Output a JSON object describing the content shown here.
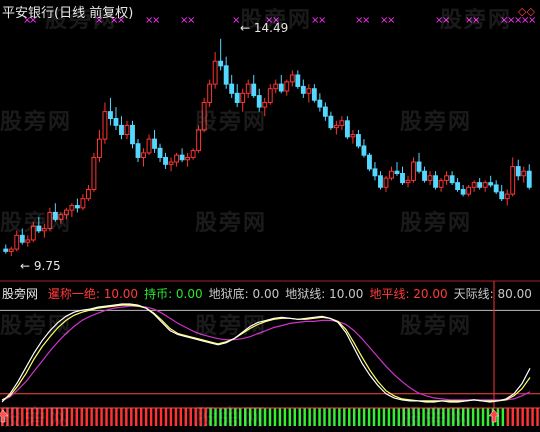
{
  "header": {
    "title": "平安银行(日线 前复权)",
    "diamond": "◇◇"
  },
  "indicator": {
    "name": "股旁网",
    "items": [
      {
        "label": "暹称一绝",
        "value": "10.00",
        "color": "#ff3b3b"
      },
      {
        "label": "持币",
        "value": "0.00",
        "color": "#2ee62e"
      },
      {
        "label": "地狱底",
        "value": "0.00",
        "color": "#c8c8c8"
      },
      {
        "label": "地狱线",
        "value": "10.00",
        "color": "#c8c8c8"
      },
      {
        "label": "地平线",
        "value": "20.00",
        "color": "#ff3b3b"
      },
      {
        "label": "天际线",
        "value": "80.00",
        "color": "#c8c8c8"
      }
    ],
    "tail": "神1"
  },
  "watermark": "股旁网",
  "markers": {
    "high": "14.49",
    "low": "9.75"
  },
  "colors": {
    "up": "#ff3333",
    "down": "#54d8ff",
    "x_marks": "#ff33ff",
    "osc_white": "#ffffff",
    "osc_yellow": "#ffff66",
    "osc_magenta": "#cc33cc",
    "hist_red": "#ff3333",
    "hist_green": "#33ee33"
  },
  "chart_data": {
    "type": "candlestick",
    "price_range": [
      9.4,
      14.9
    ],
    "candles": [
      [
        9.9,
        10.0,
        9.8,
        9.85
      ],
      [
        9.85,
        9.95,
        9.75,
        9.9
      ],
      [
        9.9,
        10.3,
        9.85,
        10.2
      ],
      [
        10.2,
        10.35,
        10.0,
        10.05
      ],
      [
        10.05,
        10.2,
        9.95,
        10.1
      ],
      [
        10.1,
        10.5,
        10.05,
        10.4
      ],
      [
        10.4,
        10.6,
        10.25,
        10.3
      ],
      [
        10.3,
        10.45,
        10.15,
        10.35
      ],
      [
        10.35,
        10.8,
        10.3,
        10.7
      ],
      [
        10.7,
        10.9,
        10.5,
        10.55
      ],
      [
        10.55,
        10.7,
        10.45,
        10.65
      ],
      [
        10.65,
        10.8,
        10.55,
        10.75
      ],
      [
        10.75,
        10.9,
        10.6,
        10.85
      ],
      [
        10.85,
        11.0,
        10.7,
        10.8
      ],
      [
        10.8,
        11.1,
        10.75,
        11.0
      ],
      [
        11.0,
        11.3,
        10.95,
        11.2
      ],
      [
        11.2,
        12.0,
        11.15,
        11.9
      ],
      [
        11.9,
        12.5,
        11.8,
        12.3
      ],
      [
        12.3,
        13.1,
        12.2,
        12.9
      ],
      [
        12.9,
        13.2,
        12.6,
        12.75
      ],
      [
        12.75,
        13.0,
        12.5,
        12.6
      ],
      [
        12.6,
        12.8,
        12.3,
        12.4
      ],
      [
        12.4,
        12.7,
        12.3,
        12.6
      ],
      [
        12.6,
        12.7,
        12.1,
        12.2
      ],
      [
        12.2,
        12.3,
        11.8,
        11.9
      ],
      [
        11.9,
        12.1,
        11.7,
        12.0
      ],
      [
        12.0,
        12.4,
        11.95,
        12.3
      ],
      [
        12.3,
        12.5,
        12.0,
        12.1
      ],
      [
        12.1,
        12.2,
        11.8,
        11.9
      ],
      [
        11.9,
        12.0,
        11.65,
        11.75
      ],
      [
        11.75,
        11.9,
        11.6,
        11.8
      ],
      [
        11.8,
        12.0,
        11.7,
        11.95
      ],
      [
        11.95,
        12.1,
        11.8,
        11.85
      ],
      [
        11.85,
        12.0,
        11.7,
        11.9
      ],
      [
        11.9,
        12.1,
        11.85,
        12.05
      ],
      [
        12.05,
        12.6,
        12.0,
        12.5
      ],
      [
        12.5,
        13.2,
        12.45,
        13.1
      ],
      [
        13.1,
        13.6,
        13.0,
        13.5
      ],
      [
        13.5,
        14.2,
        13.4,
        14.0
      ],
      [
        14.0,
        14.49,
        13.8,
        13.9
      ],
      [
        13.9,
        14.1,
        13.4,
        13.5
      ],
      [
        13.5,
        13.7,
        13.2,
        13.3
      ],
      [
        13.3,
        13.5,
        13.0,
        13.1
      ],
      [
        13.1,
        13.4,
        12.9,
        13.3
      ],
      [
        13.3,
        13.6,
        13.2,
        13.5
      ],
      [
        13.5,
        13.7,
        13.2,
        13.25
      ],
      [
        13.25,
        13.4,
        12.9,
        13.0
      ],
      [
        13.0,
        13.2,
        12.8,
        13.1
      ],
      [
        13.1,
        13.5,
        13.05,
        13.4
      ],
      [
        13.4,
        13.6,
        13.3,
        13.5
      ],
      [
        13.5,
        13.7,
        13.3,
        13.35
      ],
      [
        13.35,
        13.6,
        13.25,
        13.55
      ],
      [
        13.55,
        13.8,
        13.45,
        13.7
      ],
      [
        13.7,
        13.8,
        13.4,
        13.45
      ],
      [
        13.45,
        13.6,
        13.2,
        13.3
      ],
      [
        13.3,
        13.5,
        13.1,
        13.4
      ],
      [
        13.4,
        13.5,
        13.1,
        13.15
      ],
      [
        13.15,
        13.3,
        12.9,
        13.0
      ],
      [
        13.0,
        13.1,
        12.7,
        12.8
      ],
      [
        12.8,
        12.9,
        12.5,
        12.55
      ],
      [
        12.55,
        12.7,
        12.4,
        12.6
      ],
      [
        12.6,
        12.8,
        12.5,
        12.7
      ],
      [
        12.7,
        12.8,
        12.3,
        12.35
      ],
      [
        12.35,
        12.5,
        12.2,
        12.4
      ],
      [
        12.4,
        12.5,
        12.1,
        12.15
      ],
      [
        12.15,
        12.3,
        11.9,
        11.95
      ],
      [
        11.95,
        12.0,
        11.6,
        11.65
      ],
      [
        11.65,
        11.8,
        11.4,
        11.5
      ],
      [
        11.5,
        11.6,
        11.2,
        11.25
      ],
      [
        11.25,
        11.5,
        11.15,
        11.45
      ],
      [
        11.45,
        11.7,
        11.4,
        11.6
      ],
      [
        11.6,
        11.8,
        11.5,
        11.55
      ],
      [
        11.55,
        11.7,
        11.3,
        11.35
      ],
      [
        11.35,
        11.5,
        11.25,
        11.4
      ],
      [
        11.4,
        11.9,
        11.35,
        11.8
      ],
      [
        11.8,
        12.0,
        11.55,
        11.6
      ],
      [
        11.6,
        11.7,
        11.35,
        11.4
      ],
      [
        11.4,
        11.6,
        11.3,
        11.5
      ],
      [
        11.5,
        11.6,
        11.2,
        11.25
      ],
      [
        11.25,
        11.45,
        11.15,
        11.4
      ],
      [
        11.4,
        11.6,
        11.3,
        11.5
      ],
      [
        11.5,
        11.6,
        11.3,
        11.35
      ],
      [
        11.35,
        11.45,
        11.15,
        11.2
      ],
      [
        11.2,
        11.3,
        11.05,
        11.1
      ],
      [
        11.1,
        11.3,
        11.05,
        11.25
      ],
      [
        11.25,
        11.4,
        11.15,
        11.35
      ],
      [
        11.35,
        11.45,
        11.2,
        11.25
      ],
      [
        11.25,
        11.4,
        11.15,
        11.35
      ],
      [
        11.35,
        11.5,
        11.25,
        11.3
      ],
      [
        11.3,
        11.4,
        11.1,
        11.15
      ],
      [
        11.15,
        11.3,
        10.95,
        11.0
      ],
      [
        11.0,
        11.2,
        10.85,
        11.1
      ],
      [
        11.1,
        11.9,
        11.05,
        11.7
      ],
      [
        11.7,
        11.85,
        11.4,
        11.5
      ],
      [
        11.5,
        11.7,
        11.35,
        11.6
      ],
      [
        11.6,
        11.75,
        11.2,
        11.25
      ]
    ],
    "oscillator": {
      "range": [
        0,
        100
      ],
      "levels": [
        0,
        10,
        20,
        80
      ],
      "white": [
        2,
        10,
        22,
        36,
        50,
        62,
        72,
        80,
        86,
        90,
        92,
        93,
        95,
        96,
        97,
        98,
        98,
        97,
        94,
        88,
        80,
        72,
        68,
        66,
        64,
        62,
        60,
        58,
        60,
        64,
        70,
        76,
        80,
        82,
        84,
        85,
        84,
        83,
        84,
        85,
        86,
        84,
        80,
        70,
        55,
        40,
        28,
        18,
        10,
        6,
        4,
        3,
        3,
        2,
        2,
        3,
        2,
        2,
        3,
        4,
        3,
        2,
        3,
        5,
        10,
        20,
        35
      ],
      "yellow": [
        4,
        8,
        18,
        30,
        44,
        56,
        66,
        75,
        82,
        87,
        90,
        92,
        94,
        95,
        96,
        97,
        97,
        96,
        94,
        89,
        82,
        74,
        69,
        67,
        65,
        63,
        61,
        59,
        61,
        64,
        69,
        74,
        78,
        81,
        83,
        84,
        84,
        83,
        83,
        84,
        85,
        84,
        81,
        73,
        60,
        46,
        33,
        22,
        13,
        8,
        5,
        4,
        3,
        3,
        3,
        3,
        3,
        3,
        3,
        4,
        3,
        3,
        3,
        4,
        8,
        15,
        26
      ],
      "magenta": [
        3,
        7,
        14,
        22,
        32,
        42,
        52,
        61,
        69,
        76,
        82,
        86,
        89,
        92,
        94,
        95,
        96,
        96,
        95,
        93,
        89,
        84,
        79,
        75,
        71,
        68,
        66,
        64,
        63,
        63,
        64,
        66,
        69,
        72,
        75,
        77,
        79,
        80,
        81,
        81,
        82,
        82,
        81,
        78,
        72,
        64,
        55,
        46,
        37,
        29,
        22,
        16,
        11,
        8,
        6,
        5,
        4,
        4,
        4,
        4,
        4,
        4,
        4,
        4,
        5,
        8,
        12
      ],
      "histogram": [
        "r",
        "r",
        "r",
        "r",
        "r",
        "r",
        "r",
        "r",
        "r",
        "r",
        "r",
        "r",
        "r",
        "r",
        "r",
        "r",
        "r",
        "r",
        "r",
        "r",
        "r",
        "r",
        "r",
        "r",
        "r",
        "r",
        "r",
        "r",
        "r",
        "r",
        "r",
        "r",
        "r",
        "r",
        "r",
        "r",
        "r",
        "r",
        "r",
        "r",
        "r",
        "r",
        "g",
        "g",
        "g",
        "g",
        "g",
        "g",
        "g",
        "g",
        "g",
        "g",
        "g",
        "g",
        "g",
        "g",
        "g",
        "g",
        "g",
        "g",
        "g",
        "g",
        "g",
        "g",
        "g",
        "g",
        "g",
        "g",
        "g",
        "g",
        "g",
        "g",
        "g",
        "g",
        "g",
        "g",
        "g",
        "g",
        "g",
        "g",
        "g",
        "g",
        "g",
        "g",
        "g",
        "g",
        "g",
        "g",
        "g",
        "g",
        "g",
        "g",
        "g",
        "g",
        "g",
        "g",
        "g",
        "g",
        "g",
        "g",
        "g",
        "g",
        "r",
        "r",
        "r",
        "r",
        "r",
        "r",
        "r"
      ]
    }
  }
}
